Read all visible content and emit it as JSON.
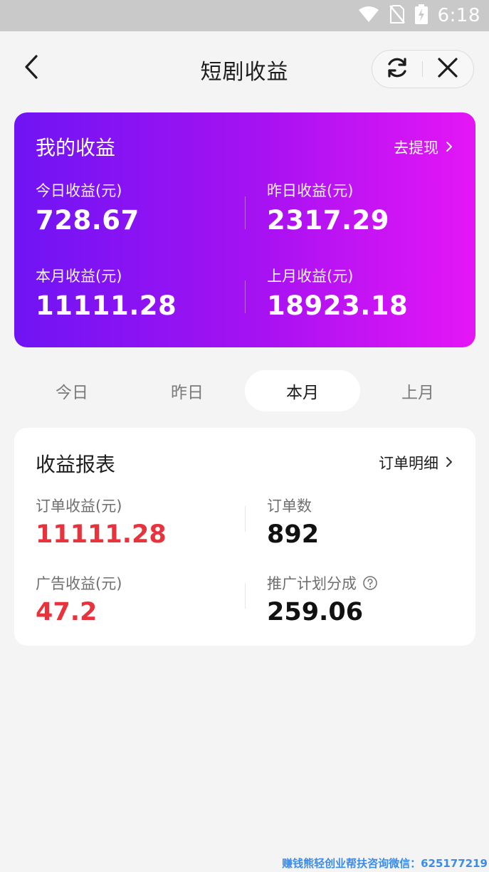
{
  "status_bar": {
    "time": "6:18",
    "icons": [
      "wifi-icon",
      "no-sim-icon",
      "battery-charging-icon"
    ]
  },
  "header": {
    "title": "短剧收益",
    "icons": [
      "back-arrow-icon",
      "refresh-icon",
      "close-icon"
    ]
  },
  "earnings": {
    "title": "我的收益",
    "withdraw_label": "去提现",
    "today_label": "今日收益(元)",
    "today_value": "728.67",
    "yesterday_label": "昨日收益(元)",
    "yesterday_value": "2317.29",
    "this_month_label": "本月收益(元)",
    "this_month_value": "11111.28",
    "last_month_label": "上月收益(元)",
    "last_month_value": "18923.18"
  },
  "tabs": [
    {
      "label": "今日",
      "active": false
    },
    {
      "label": "昨日",
      "active": false
    },
    {
      "label": "本月",
      "active": true
    },
    {
      "label": "上月",
      "active": false
    }
  ],
  "report": {
    "title": "收益报表",
    "detail_label": "订单明细",
    "order_income_label": "订单收益(元)",
    "order_income_value": "11111.28",
    "order_count_label": "订单数",
    "order_count_value": "892",
    "ad_income_label": "广告收益(元)",
    "ad_income_value": "47.2",
    "promo_share_label": "推广计划分成",
    "promo_share_value": "259.06"
  },
  "watermark": "赚钱熊轻创业帮扶咨询微信：625177219",
  "colors": {
    "card_gradient_start": "#6f14f4",
    "card_gradient_end": "#e516f6",
    "highlight_red": "#e8323c",
    "page_background": "#f4f4f5"
  }
}
